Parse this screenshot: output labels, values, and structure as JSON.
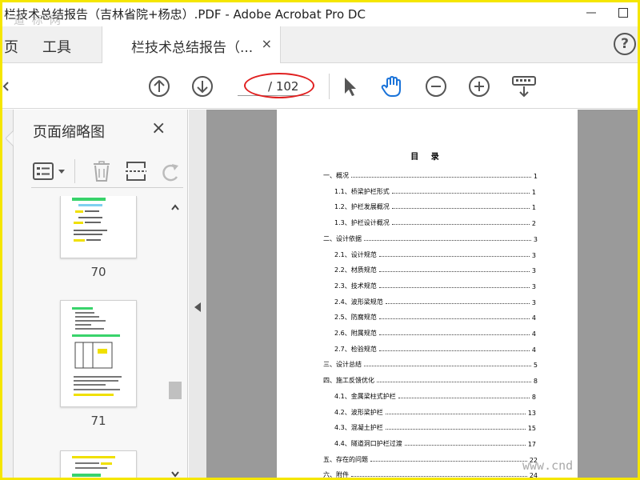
{
  "window": {
    "title": "栏技术总结报告（吉林省院+杨忠）.PDF - Adobe Acrobat Pro DC",
    "watermark_top": "道 标 网",
    "watermark_bottom": "www.cnd"
  },
  "tabs": {
    "page_partial": "页",
    "tools": "工具",
    "document": "栏技术总结报告（...",
    "close_glyph": "×"
  },
  "toolbar": {
    "current_page": "",
    "total_pages": "/ 102"
  },
  "thumbnails_panel": {
    "title": "页面缩略图",
    "close_glyph": "×",
    "items": [
      {
        "page": "70"
      },
      {
        "page": "71"
      }
    ]
  },
  "document": {
    "toc_title": "目 录",
    "toc": [
      {
        "level": 1,
        "label": "一、概况",
        "page": "1"
      },
      {
        "level": 2,
        "label": "1.1、桥梁护栏形式",
        "page": "1"
      },
      {
        "level": 2,
        "label": "1.2、护栏发展概况",
        "page": "1"
      },
      {
        "level": 2,
        "label": "1.3、护栏设计概况",
        "page": "2"
      },
      {
        "level": 1,
        "label": "二、设计依据",
        "page": "3"
      },
      {
        "level": 2,
        "label": "2.1、设计规范",
        "page": "3"
      },
      {
        "level": 2,
        "label": "2.2、材质规范",
        "page": "3"
      },
      {
        "level": 2,
        "label": "2.3、技术规范",
        "page": "3"
      },
      {
        "level": 2,
        "label": "2.4、波形梁规范",
        "page": "3"
      },
      {
        "level": 2,
        "label": "2.5、防腐规范",
        "page": "4"
      },
      {
        "level": 2,
        "label": "2.6、附属规范",
        "page": "4"
      },
      {
        "level": 2,
        "label": "2.7、检验规范",
        "page": "4"
      },
      {
        "level": 1,
        "label": "三、设计总结",
        "page": "5"
      },
      {
        "level": 1,
        "label": "四、施工反馈优化",
        "page": "8"
      },
      {
        "level": 2,
        "label": "4.1、金属梁柱式护栏",
        "page": "8"
      },
      {
        "level": 2,
        "label": "4.2、波形梁护栏",
        "page": "13"
      },
      {
        "level": 2,
        "label": "4.3、混凝土护栏",
        "page": "15"
      },
      {
        "level": 2,
        "label": "4.4、隧道洞口护栏过渡",
        "page": "17"
      },
      {
        "level": 1,
        "label": "五、存在的问题",
        "page": "22"
      },
      {
        "level": 1,
        "label": "六、附件",
        "page": "24"
      }
    ]
  },
  "colors": {
    "frame": "#f5e600",
    "hand_tool": "#1a73d9",
    "annotation": "#e02020",
    "doc_bg": "#9a9a9a"
  }
}
